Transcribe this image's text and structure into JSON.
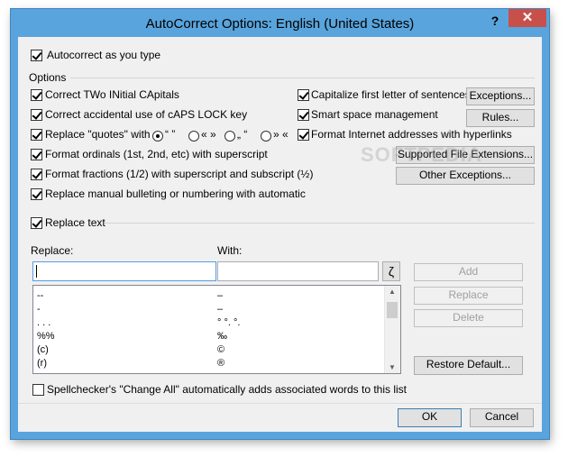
{
  "window": {
    "title": "AutoCorrect Options: English (United States)",
    "help_glyph": "?",
    "close_glyph": "✕"
  },
  "autocorrect_as_you_type": "Autocorrect as you type",
  "options_group_label": "Options",
  "left_options": [
    "Correct TWo INitial CApitals",
    "Correct accidental use of cAPS LOCK key",
    "Replace \"quotes\" with",
    "Format ordinals (1st, 2nd, etc) with superscript",
    "Format fractions (1/2) with superscript and subscript (½)",
    "Replace manual bulleting or numbering with automatic"
  ],
  "quote_styles": [
    "“ ”",
    "« »",
    "„ “",
    "» «"
  ],
  "right_options": [
    "Capitalize first letter of sentences",
    "Smart space management",
    "Format Internet addresses with hyperlinks"
  ],
  "buttons": {
    "exceptions": "Exceptions...",
    "rules": "Rules...",
    "supported_ext": "Supported File Extensions...",
    "other_exceptions": "Other Exceptions...",
    "add": "Add",
    "replace": "Replace",
    "delete": "Delete",
    "restore": "Restore Default...",
    "ok": "OK",
    "cancel": "Cancel"
  },
  "replace_text_label": "Replace text",
  "replace_col_label": "Replace:",
  "with_col_label": "With:",
  "symbol_glyph": "ζ",
  "replace_input_value": "",
  "with_input_value": "",
  "entries": [
    {
      "replace": "--",
      "with": "–"
    },
    {
      "replace": "-",
      "with": "–"
    },
    {
      "replace": ". . .",
      "with": "° °. °."
    },
    {
      "replace": "%%",
      "with": "‰"
    },
    {
      "replace": "(c)",
      "with": "©"
    },
    {
      "replace": "(r)",
      "with": "®"
    }
  ],
  "spellchecker_label": "Spellchecker's \"Change All\" automatically adds associated words to this list",
  "watermark": "SOFTPEDIA"
}
